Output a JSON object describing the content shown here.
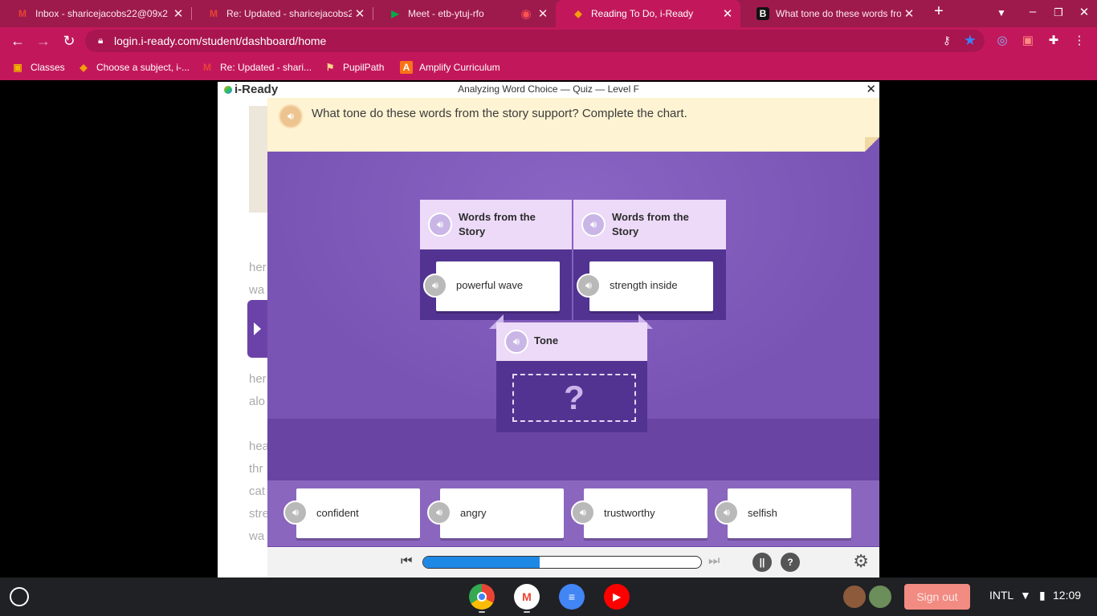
{
  "browser": {
    "tabs": [
      {
        "label": "Inbox - sharicejacobs22@09x2",
        "favicon": "M",
        "favicon_color": "#ea4335",
        "active": false
      },
      {
        "label": "Re: Updated - sharicejacobs22",
        "favicon": "M",
        "favicon_color": "#ea4335",
        "active": false
      },
      {
        "label": "Meet - etb-ytuj-rfo",
        "favicon": "▶",
        "favicon_color": "#00ac47",
        "active": false
      },
      {
        "label": "Reading To Do, i-Ready",
        "favicon": "◆",
        "favicon_color": "#f59e0b",
        "active": true
      },
      {
        "label": "What tone do these words from",
        "favicon": "B",
        "favicon_color": "#111111",
        "active": false
      }
    ],
    "new_tab": "+",
    "url": "login.i-ready.com/student/dashboard/home",
    "bookmarks": [
      {
        "label": "Classes",
        "icon": "▣",
        "icon_color": "#f4b400"
      },
      {
        "label": "Choose a subject, i-...",
        "icon": "◆",
        "icon_color": "#f59e0b"
      },
      {
        "label": "Re: Updated - shari...",
        "icon": "M",
        "icon_color": "#ea4335"
      },
      {
        "label": "PupilPath",
        "icon": "⚑",
        "icon_color": "#f9d58a"
      },
      {
        "label": "Amplify Curriculum",
        "icon": "A",
        "icon_color": "#f97316"
      }
    ]
  },
  "app": {
    "logo": "i-Ready",
    "title": "Analyzing Word Choice — Quiz — Level F",
    "close": "✕"
  },
  "story": {
    "lines": [
      "her",
      "wa",
      "her",
      "alo",
      "hea",
      "thr",
      "cat",
      "stre",
      "wa"
    ]
  },
  "question": {
    "text": "What tone do these words from the story support? Complete the chart."
  },
  "chart": {
    "columns": [
      {
        "title": "Words from the Story",
        "card": "powerful wave"
      },
      {
        "title": "Words from the Story",
        "card": "strength inside"
      }
    ],
    "tone": {
      "title": "Tone",
      "placeholder": "?"
    }
  },
  "choices": [
    "confident",
    "angry",
    "trustworthy",
    "selfish"
  ],
  "controls": {
    "progress": 0.42,
    "help": "?",
    "pause": "||"
  },
  "shelf": {
    "apps": [
      {
        "name": "chrome",
        "label": "●",
        "color": "#4285f4"
      },
      {
        "name": "gmail",
        "label": "M",
        "color": "#ea4335"
      },
      {
        "name": "docs",
        "label": "≡",
        "color": "#4285f4"
      },
      {
        "name": "youtube",
        "label": "▶",
        "color": "#ff0000"
      }
    ],
    "signout": "Sign out",
    "ime": "INTL",
    "time": "12:09"
  }
}
